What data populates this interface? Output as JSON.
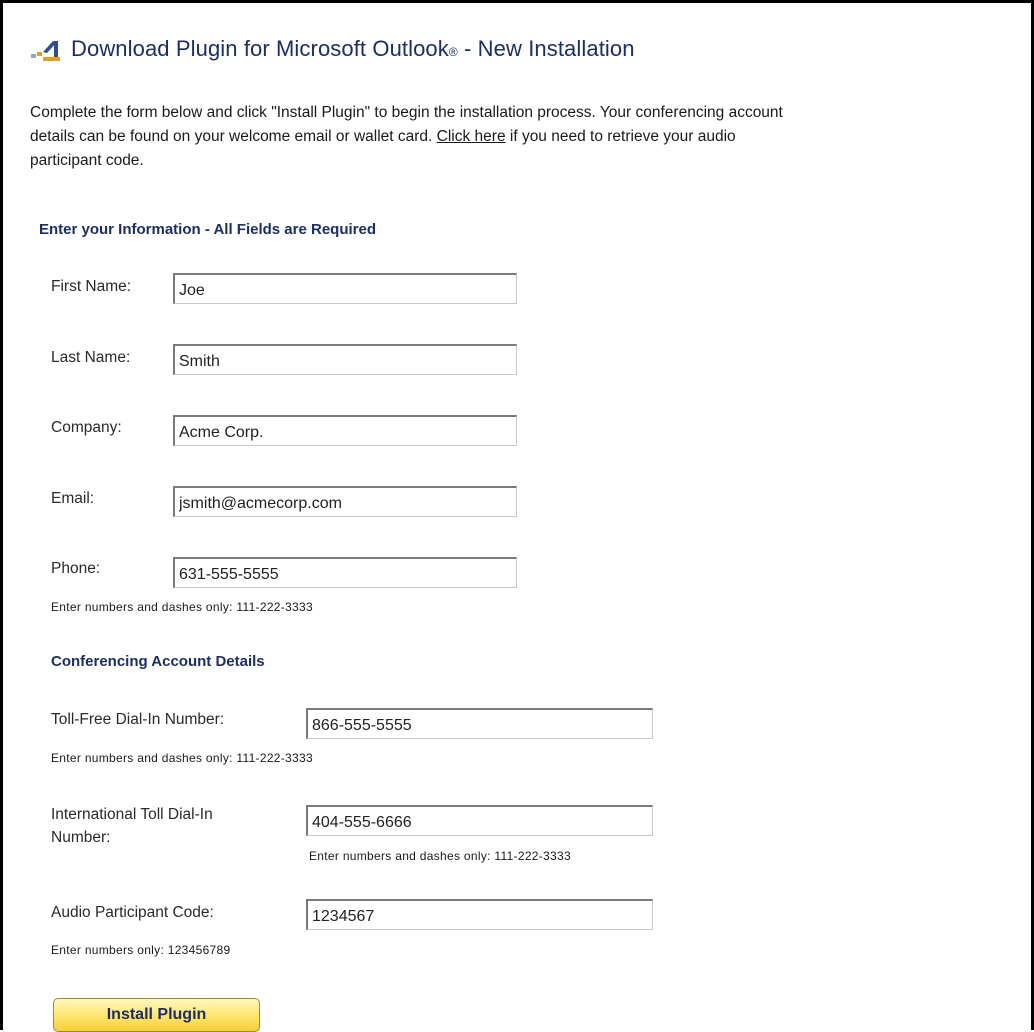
{
  "header": {
    "title_main": "Download Plugin for Microsoft Outlook",
    "title_reg": "®",
    "title_suffix": " - New Installation",
    "icon": "plugin-icon"
  },
  "intro": {
    "line1": "Complete the form below and click \"Install Plugin\" to begin the installation process. Your conferencing account",
    "line2_before": "details can be found on your welcome email or wallet card. ",
    "link_text": "Click here",
    "line2_after": " if you need to retrieve your audio",
    "line3": "participant code."
  },
  "info_section": {
    "heading": "Enter your Information - All Fields are Required",
    "first_name": {
      "label": "First Name:",
      "value": "Joe"
    },
    "last_name": {
      "label": "Last Name:",
      "value": "Smith"
    },
    "company": {
      "label": "Company:",
      "value": "Acme Corp."
    },
    "email": {
      "label": "Email:",
      "value": "jsmith@acmecorp.com"
    },
    "phone": {
      "label": "Phone:",
      "value": "631-555-5555",
      "hint": "Enter numbers and dashes only: 111-222-3333"
    }
  },
  "account_section": {
    "heading": "Conferencing Account Details",
    "toll_free": {
      "label": "Toll-Free Dial-In Number:",
      "value": "866-555-5555",
      "hint": "Enter numbers and dashes only: 111-222-3333"
    },
    "international": {
      "label_line1": "International Toll Dial-In",
      "label_line2": "Number:",
      "value": "404-555-6666",
      "hint": "Enter numbers and dashes only: 111-222-3333"
    },
    "participant_code": {
      "label": "Audio Participant Code:",
      "value": "1234567",
      "hint": "Enter numbers only: 123456789"
    }
  },
  "actions": {
    "install_label": "Install Plugin"
  },
  "colors": {
    "heading": "#1b2e6b",
    "button_top": "#fff7c2",
    "button_bottom": "#f5cf35"
  }
}
